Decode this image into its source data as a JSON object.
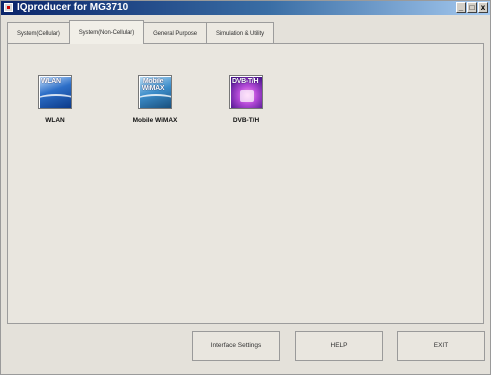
{
  "window": {
    "title": "IQproducer for MG3710",
    "controls": {
      "minimize": "_",
      "restore": "□",
      "close": "x"
    }
  },
  "tabs": [
    {
      "label": "System(Cellular)",
      "active": false
    },
    {
      "label": "System(Non-Cellular)",
      "active": true
    },
    {
      "label": "General Purpose",
      "active": false
    },
    {
      "label": "Simulation & Utility",
      "active": false
    }
  ],
  "apps": [
    {
      "label": "WLAN",
      "icon_caption": "WLAN",
      "icon": "wlan-icon"
    },
    {
      "label": "Mobile WiMAX",
      "icon_caption": "Mobile WiMAX",
      "icon": "mobile-wimax-icon"
    },
    {
      "label": "DVB-T/H",
      "icon_caption": "DVB-T/H",
      "icon": "dvb-th-icon"
    }
  ],
  "footer": {
    "interface_settings": "Interface Settings",
    "help": "HELP",
    "exit": "EXIT"
  }
}
